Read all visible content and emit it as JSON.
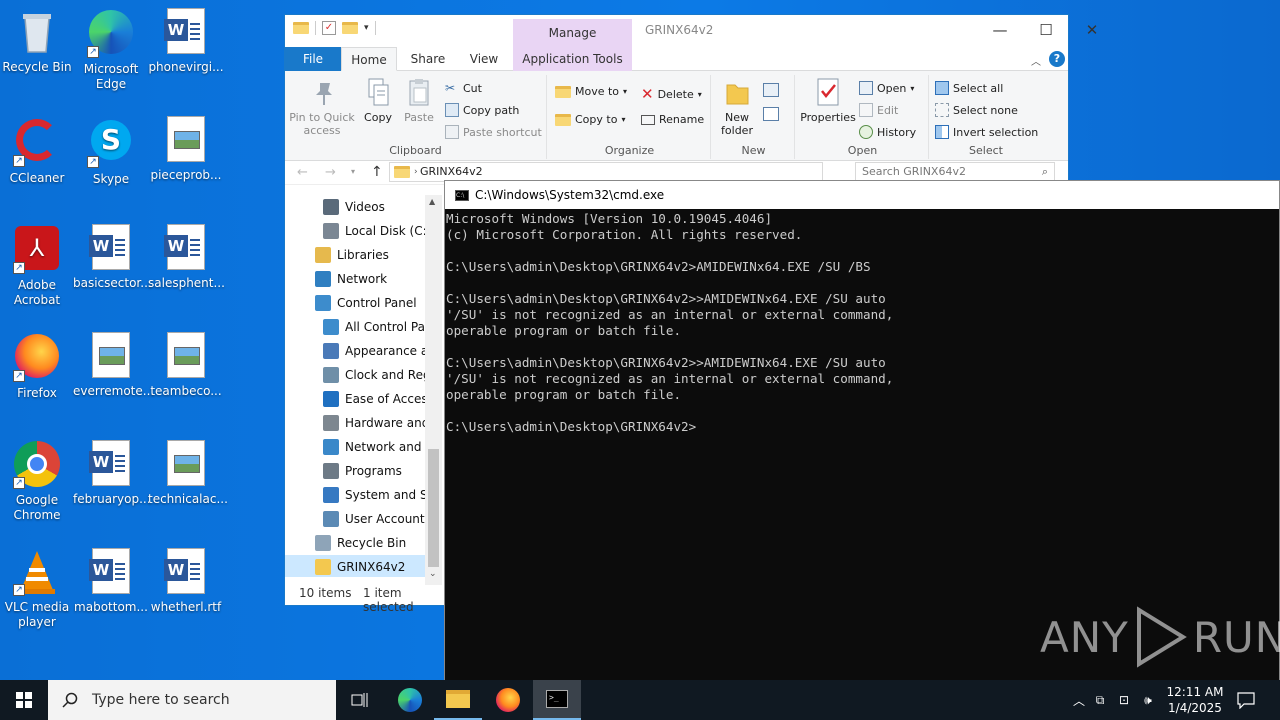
{
  "desktop": {
    "icons": [
      {
        "label": "Recycle Bin",
        "kind": "recycle"
      },
      {
        "label": "Microsoft Edge",
        "kind": "edge"
      },
      {
        "label": "phonevirgi...",
        "kind": "word"
      },
      {
        "label": "CCleaner",
        "kind": "ccleaner"
      },
      {
        "label": "Skype",
        "kind": "skype"
      },
      {
        "label": "pieceprob...",
        "kind": "image"
      },
      {
        "label": "Adobe Acrobat",
        "kind": "acrobat"
      },
      {
        "label": "basicsector...",
        "kind": "word"
      },
      {
        "label": "salesphent...",
        "kind": "word"
      },
      {
        "label": "Firefox",
        "kind": "firefox"
      },
      {
        "label": "everremote...",
        "kind": "image"
      },
      {
        "label": "teambeco...",
        "kind": "image"
      },
      {
        "label": "Google Chrome",
        "kind": "chrome"
      },
      {
        "label": "februaryop...",
        "kind": "word"
      },
      {
        "label": "technicalac...",
        "kind": "image"
      },
      {
        "label": "VLC media player",
        "kind": "vlc"
      },
      {
        "label": "mabottom...",
        "kind": "word"
      },
      {
        "label": "whetherl.rtf",
        "kind": "word"
      }
    ]
  },
  "explorer": {
    "title": "GRINX64v2",
    "manage_label": "Manage",
    "tabs": {
      "file": "File",
      "home": "Home",
      "share": "Share",
      "view": "View",
      "app_tools": "Application Tools"
    },
    "ribbon": {
      "clipboard": {
        "label": "Clipboard",
        "pin": "Pin to Quick access",
        "copy": "Copy",
        "paste": "Paste",
        "cut": "Cut",
        "copy_path": "Copy path",
        "paste_shortcut": "Paste shortcut"
      },
      "organize": {
        "label": "Organize",
        "move_to": "Move to",
        "copy_to": "Copy to",
        "delete": "Delete",
        "rename": "Rename"
      },
      "new": {
        "label": "New",
        "new_folder": "New folder"
      },
      "open": {
        "label": "Open",
        "properties": "Properties",
        "open": "Open",
        "edit": "Edit",
        "history": "History"
      },
      "select": {
        "label": "Select",
        "select_all": "Select all",
        "select_none": "Select none",
        "invert": "Invert selection"
      }
    },
    "address": {
      "path": "GRINX64v2",
      "search_placeholder": "Search GRINX64v2"
    },
    "nav": [
      {
        "label": "Videos",
        "color": "#5a6a7a",
        "indent": 1
      },
      {
        "label": "Local Disk (C:)",
        "color": "#7b8794",
        "indent": 1
      },
      {
        "label": "Libraries",
        "color": "#e6b94d",
        "indent": 0
      },
      {
        "label": "Network",
        "color": "#2f7fc1",
        "indent": 0
      },
      {
        "label": "Control Panel",
        "color": "#3d8ccc",
        "indent": 0
      },
      {
        "label": "All Control Panel Items",
        "color": "#3d8ccc",
        "indent": 1
      },
      {
        "label": "Appearance and Personalization",
        "color": "#4a7ab8",
        "indent": 1
      },
      {
        "label": "Clock and Region",
        "color": "#6f8fa8",
        "indent": 1
      },
      {
        "label": "Ease of Access",
        "color": "#1f70c1",
        "indent": 1
      },
      {
        "label": "Hardware and Sound",
        "color": "#7d8790",
        "indent": 1
      },
      {
        "label": "Network and Internet",
        "color": "#3a88c9",
        "indent": 1
      },
      {
        "label": "Programs",
        "color": "#6d7a86",
        "indent": 1
      },
      {
        "label": "System and Security",
        "color": "#3679c2",
        "indent": 1
      },
      {
        "label": "User Accounts",
        "color": "#5b8ab5",
        "indent": 1
      },
      {
        "label": "Recycle Bin",
        "color": "#8ea4b8",
        "indent": 0
      },
      {
        "label": "GRINX64v2",
        "color": "#f3c84f",
        "indent": 0,
        "selected": true
      }
    ],
    "status": {
      "items": "10 items",
      "selected": "1 item selected"
    }
  },
  "cmd": {
    "title": "C:\\Windows\\System32\\cmd.exe",
    "lines": [
      "Microsoft Windows [Version 10.0.19045.4046]",
      "(c) Microsoft Corporation. All rights reserved.",
      "",
      "C:\\Users\\admin\\Desktop\\GRINX64v2>AMIDEWINx64.EXE /SU /BS",
      "",
      "C:\\Users\\admin\\Desktop\\GRINX64v2>>AMIDEWINx64.EXE /SU auto",
      "'/SU' is not recognized as an internal or external command,",
      "operable program or batch file.",
      "",
      "C:\\Users\\admin\\Desktop\\GRINX64v2>>AMIDEWINx64.EXE /SU auto",
      "'/SU' is not recognized as an internal or external command,",
      "operable program or batch file.",
      "",
      "C:\\Users\\admin\\Desktop\\GRINX64v2>"
    ]
  },
  "watermark": {
    "text": "ANY",
    "text2": "RUN"
  },
  "taskbar": {
    "search_placeholder": "Type here to search",
    "time": "12:11 AM",
    "date": "1/4/2025"
  }
}
